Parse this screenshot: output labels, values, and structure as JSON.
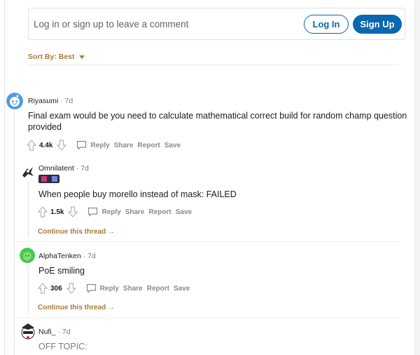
{
  "login_prompt": {
    "text": "Log in or sign up to leave a comment",
    "login_label": "Log In",
    "signup_label": "Sign Up"
  },
  "sort": {
    "label": "Sort By: Best"
  },
  "actions": {
    "reply": "Reply",
    "share": "Share",
    "report": "Report",
    "save": "Save"
  },
  "comments": [
    {
      "user": "Riyasumi",
      "time": "· 7d",
      "text_line1": "Final exam would be you need to calculate mathematical correct build for random champ question",
      "text_line2": "provided",
      "score": "4.4k"
    },
    {
      "user": "Omnilatent",
      "time": "· 7d",
      "text": "When people buy morello instead of mask: FAILED",
      "score": "1.5k",
      "continue": "Continue this thread"
    },
    {
      "user": "AlphaTenken",
      "time": "· 7d",
      "text": "PoE smiling",
      "score": "306",
      "continue": "Continue this thread"
    },
    {
      "user": "Nufi_",
      "time": "· 7d",
      "text": "OFF TOPIC:"
    }
  ],
  "colors": {
    "accent": "#0a68b0",
    "sort": "#a97a3a",
    "muted": "#878a8c"
  }
}
